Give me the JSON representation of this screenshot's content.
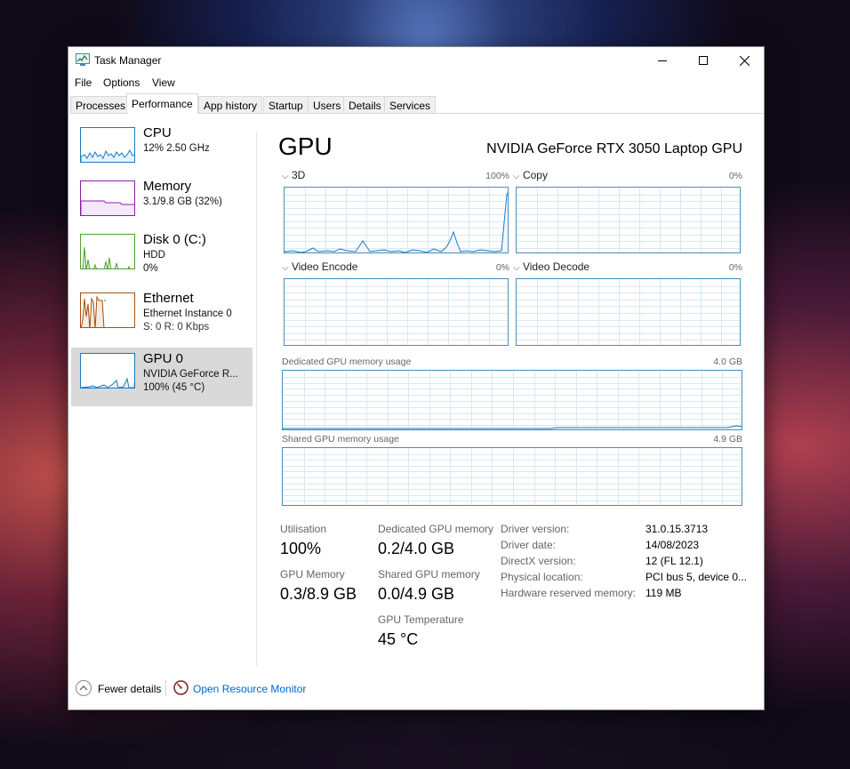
{
  "window": {
    "title": "Task Manager"
  },
  "menu": [
    "File",
    "Options",
    "View"
  ],
  "tabs": [
    "Processes",
    "Performance",
    "App history",
    "Startup",
    "Users",
    "Details",
    "Services"
  ],
  "active_tab": "Performance",
  "sidebar": {
    "items": [
      {
        "name": "CPU",
        "line1": "12%  2.50 GHz",
        "line2": "",
        "color": "#1a7ac0"
      },
      {
        "name": "Memory",
        "line1": "3.1/9.8 GB (32%)",
        "line2": "",
        "color": "#8b1fa6"
      },
      {
        "name": "Disk 0 (C:)",
        "line1": "HDD",
        "line2": "0%",
        "color": "#4ca22c"
      },
      {
        "name": "Ethernet",
        "line1": "Ethernet Instance 0",
        "line2": "S: 0  R: 0 Kbps",
        "color": "#a74e0e"
      },
      {
        "name": "GPU 0",
        "line1": "NVIDIA GeForce R...",
        "line2": "100%  (45 °C)",
        "color": "#1a7ac0"
      }
    ]
  },
  "main": {
    "title": "GPU",
    "model": "NVIDIA GeForce RTX 3050 Laptop GPU",
    "graphs": [
      {
        "label": "3D",
        "value": "100%"
      },
      {
        "label": "Copy",
        "value": "0%"
      },
      {
        "label": "Video Encode",
        "value": "0%"
      },
      {
        "label": "Video Decode",
        "value": "0%"
      }
    ],
    "dedicated_memory": {
      "label": "Dedicated GPU memory usage",
      "value": "4.0 GB"
    },
    "shared_memory": {
      "label": "Shared GPU memory usage",
      "value": "4.9 GB"
    },
    "stats": {
      "utilisation": {
        "label": "Utilisation",
        "value": "100%"
      },
      "dedicated": {
        "label": "Dedicated GPU memory",
        "value": "0.2/4.0 GB"
      },
      "gpu_memory": {
        "label": "GPU Memory",
        "value": "0.3/8.9 GB"
      },
      "shared": {
        "label": "Shared GPU memory",
        "value": "0.0/4.9 GB"
      },
      "temperature": {
        "label": "GPU Temperature",
        "value": "45 °C"
      }
    },
    "info": [
      {
        "key": "Driver version:",
        "value": "31.0.15.3713"
      },
      {
        "key": "Driver date:",
        "value": "14/08/2023"
      },
      {
        "key": "DirectX version:",
        "value": "12 (FL 12.1)"
      },
      {
        "key": "Physical location:",
        "value": "PCI bus 5, device 0..."
      },
      {
        "key": "Hardware reserved memory:",
        "value": "119 MB"
      }
    ]
  },
  "footer": {
    "fewer_details": "Fewer details",
    "resource_monitor": "Open Resource Monitor"
  }
}
